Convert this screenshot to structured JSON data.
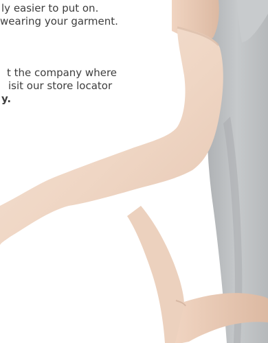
{
  "paragraph_1": {
    "line_1": "ly easier to put on.",
    "line_2": "wearing your garment."
  },
  "paragraph_2": {
    "line_1": "t the company where",
    "line_2": "isit our store locator",
    "line_3": "y."
  },
  "colors": {
    "text": "#3d3d3d",
    "sleeve": "#f1d9c8",
    "tank_top": "#b9bcbe",
    "skin": "#e9cdb8"
  }
}
